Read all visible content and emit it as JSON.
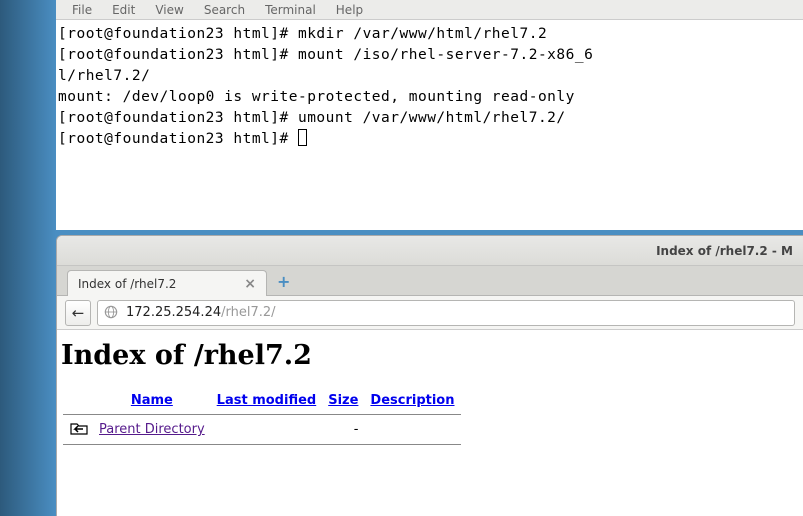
{
  "terminal": {
    "menu": [
      "File",
      "Edit",
      "View",
      "Search",
      "Terminal",
      "Help"
    ],
    "lines": [
      "[root@foundation23 html]# mkdir /var/www/html/rhel7.2",
      "[root@foundation23 html]# mount /iso/rhel-server-7.2-x86_6",
      "l/rhel7.2/",
      "mount: /dev/loop0 is write-protected, mounting read-only",
      "[root@foundation23 html]# umount /var/www/html/rhel7.2/",
      "[root@foundation23 html]# "
    ]
  },
  "browser": {
    "window_title": "Index of /rhel7.2 - M",
    "tab_title": "Index of /rhel7.2",
    "address_host": "172.25.254.24",
    "address_path": "/rhel7.2/",
    "page_heading": "Index of /rhel7.2",
    "columns": {
      "name": "Name",
      "modified": "Last modified",
      "size": "Size",
      "description": "Description"
    },
    "entries": [
      {
        "icon": "back-folder",
        "name": "Parent Directory",
        "modified": "",
        "size": "-",
        "description": ""
      }
    ]
  }
}
